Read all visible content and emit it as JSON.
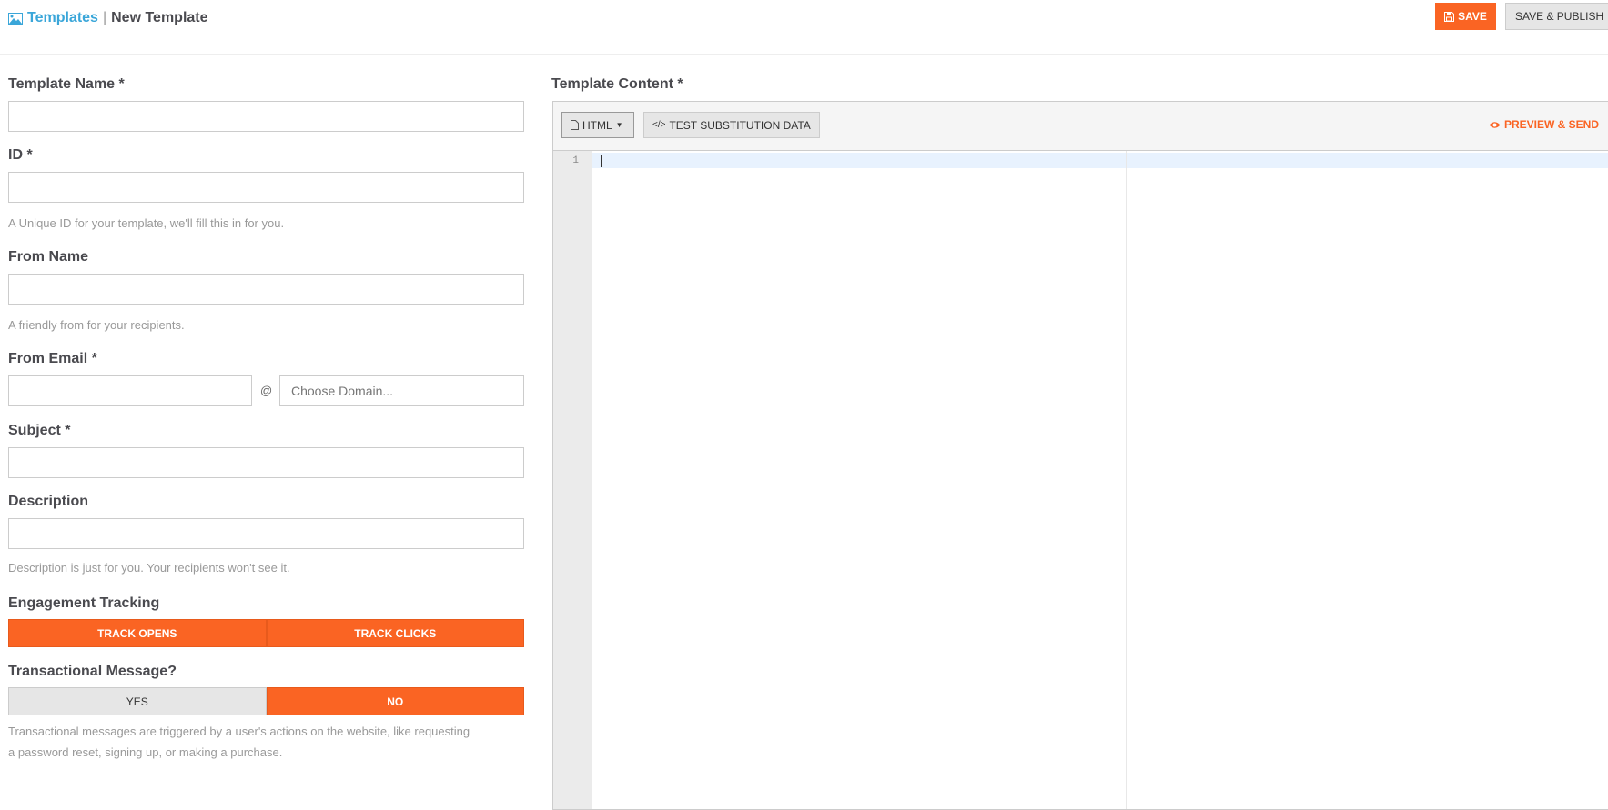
{
  "header": {
    "breadcrumb_root": "Templates",
    "separator": "|",
    "page_title": "New Template",
    "save_label": "SAVE",
    "save_publish_label": "SAVE & PUBLISH"
  },
  "form": {
    "template_name": {
      "label": "Template Name *",
      "value": ""
    },
    "id": {
      "label": "ID *",
      "value": "",
      "help": "A Unique ID for your template, we'll fill this in for you."
    },
    "from_name": {
      "label": "From Name",
      "value": "",
      "help": "A friendly from for your recipients."
    },
    "from_email": {
      "label": "From Email *",
      "value": "",
      "at": "@",
      "domain_placeholder": "Choose Domain..."
    },
    "subject": {
      "label": "Subject *",
      "value": ""
    },
    "description": {
      "label": "Description",
      "value": "",
      "help": "Description is just for you. Your recipients won't see it."
    },
    "engagement": {
      "label": "Engagement Tracking",
      "options": [
        "TRACK OPENS",
        "TRACK CLICKS"
      ],
      "active": [
        "TRACK OPENS",
        "TRACK CLICKS"
      ]
    },
    "transactional": {
      "label": "Transactional Message?",
      "options": [
        "YES",
        "NO"
      ],
      "selected": "NO",
      "help_line1": "Transactional messages are triggered by a user's actions on the website, like requesting",
      "help_line2": "a password reset, signing up, or making a purchase."
    }
  },
  "content": {
    "label": "Template Content *",
    "format_label": "HTML",
    "test_data_label": "TEST SUBSTITUTION DATA",
    "preview_label": "PREVIEW & SEND",
    "line_number": "1"
  },
  "colors": {
    "accent": "#fa6423",
    "link": "#3aa6d9"
  }
}
